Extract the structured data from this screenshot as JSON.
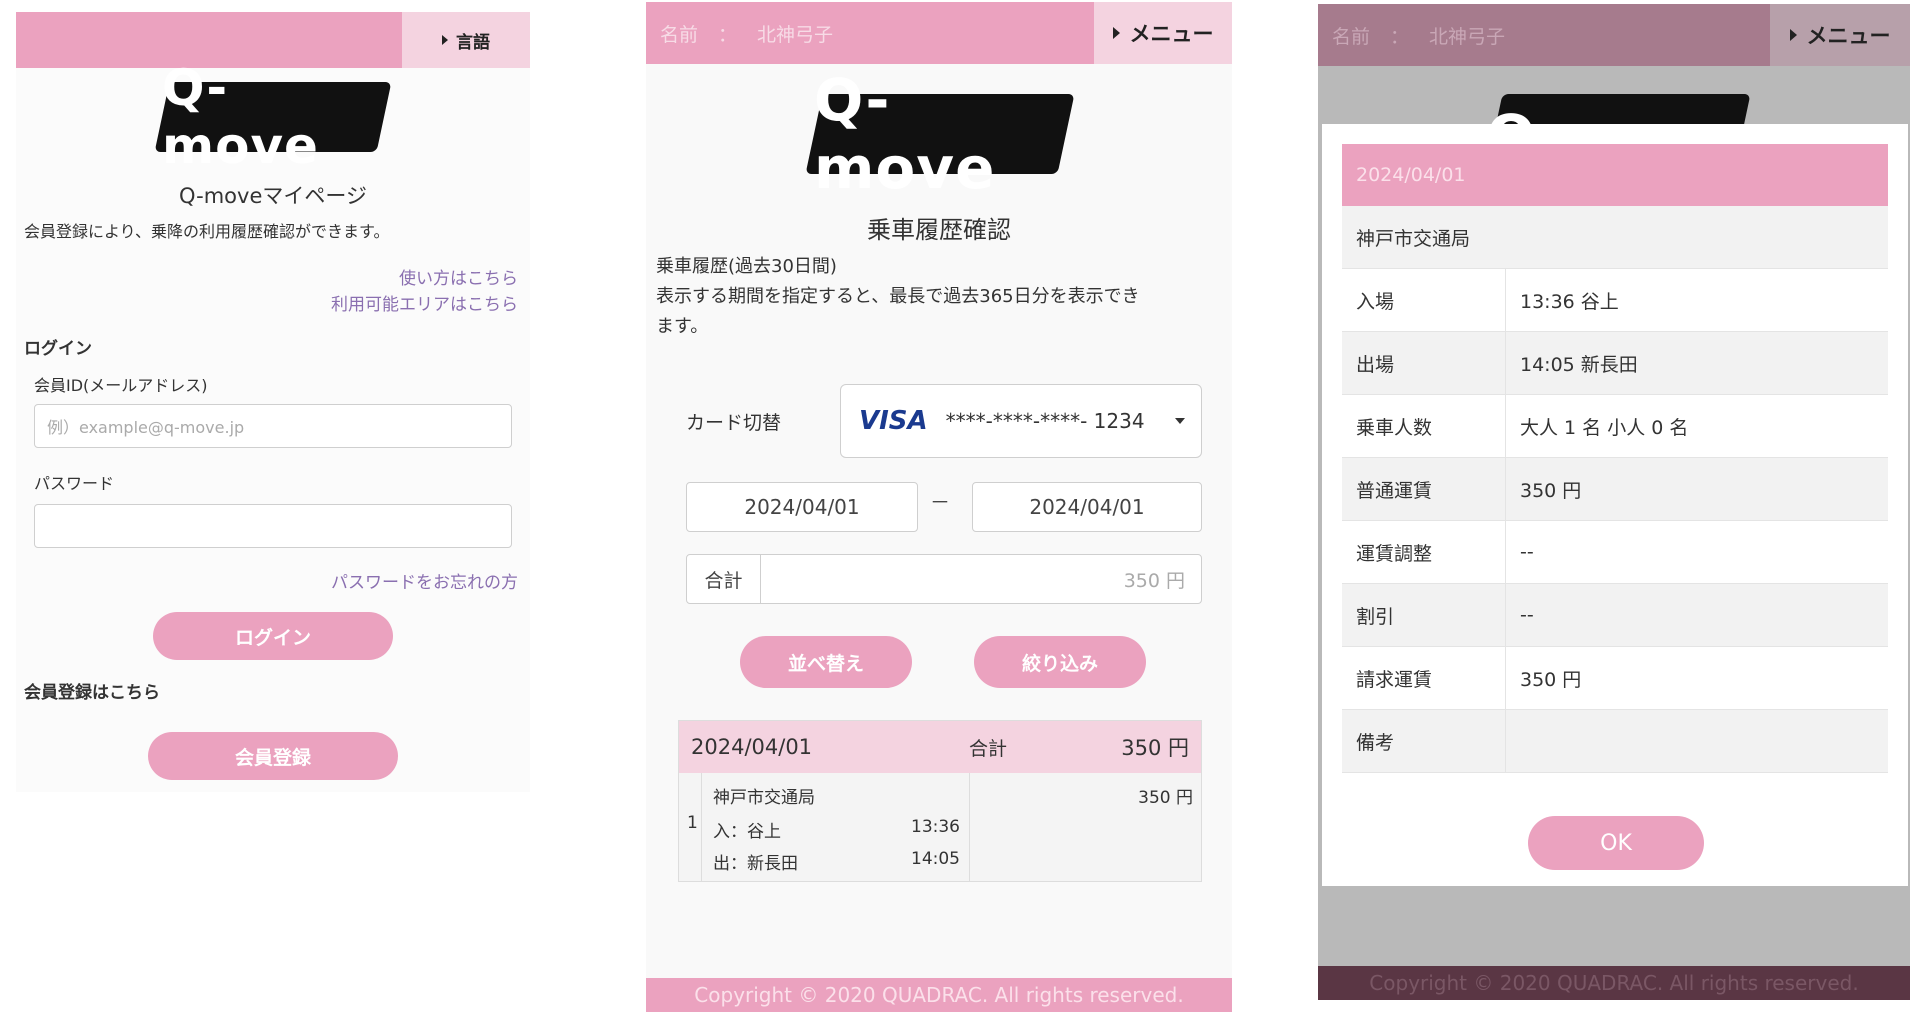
{
  "login_screen": {
    "language_label": "言語",
    "logo_text": "Q-move",
    "page_title": "Q-moveマイページ",
    "description": "会員登録により、乗降の利用履歴確認ができます。",
    "link_usage": "使い方はこちら",
    "link_area": "利用可能エリアはこちら",
    "login_heading": "ログイン",
    "member_id_label": "会員ID(メールアドレス)",
    "member_id_placeholder": "例）example@q-move.jp",
    "password_label": "パスワード",
    "forgot_password_link": "パスワードをお忘れの方",
    "login_button": "ログイン",
    "register_heading": "会員登録はこちら",
    "register_button": "会員登録"
  },
  "history_screen": {
    "name_label": "名前",
    "name_separator": "：",
    "name_value": "北神弓子",
    "menu_label": "メニュー",
    "logo_text": "Q-move",
    "page_title": "乗車履歴確認",
    "description_line1": "乗車履歴(過去30日間)",
    "description_line2": "表示する期間を指定すると、最長で過去365日分を表示でき",
    "description_line3": "ます。",
    "card_label": "カード切替",
    "card_brand": "VISA",
    "card_number": "****-****-****- 1234",
    "date_from": "2024/04/01",
    "date_separator": "－",
    "date_to": "2024/04/01",
    "total_label": "合計",
    "total_value": "350 円",
    "sort_button": "並べ替え",
    "filter_button": "絞り込み",
    "history": {
      "date": "2024/04/01",
      "total_label": "合計",
      "total_value": "350 円",
      "row_index": "1",
      "operator": "神戸市交通局",
      "entry": "入：谷上",
      "entry_time": "13:36",
      "exit": "出：新長田",
      "exit_time": "14:05",
      "fare": "350 円"
    },
    "footer": "Copyright © 2020 QUADRAC. All rights reserved."
  },
  "detail_screen": {
    "name_label": "名前",
    "name_separator": "：",
    "name_value": "北神弓子",
    "menu_label": "メニュー",
    "logo_text": "Q-move",
    "date": "2024/04/01",
    "operator": "神戸市交通局",
    "rows": [
      {
        "key": "入場",
        "value": "13:36 谷上"
      },
      {
        "key": "出場",
        "value": "14:05 新長田"
      },
      {
        "key": "乗車人数",
        "value": "大人 1 名  小人 0 名"
      },
      {
        "key": "普通運賃",
        "value": "350 円"
      },
      {
        "key": "運賃調整",
        "value": "--"
      },
      {
        "key": "割引",
        "value": "--"
      },
      {
        "key": "請求運賃",
        "value": "350 円"
      },
      {
        "key": "備考",
        "value": ""
      }
    ],
    "ok_button": "OK",
    "footer": "Copyright © 2020 QUADRAC. All rights reserved."
  },
  "colors": {
    "brand_pink": "#eba2bf",
    "light_pink": "#f4d3e0",
    "link_purple": "#8a6fb0",
    "visa_blue": "#1a3a8f"
  }
}
